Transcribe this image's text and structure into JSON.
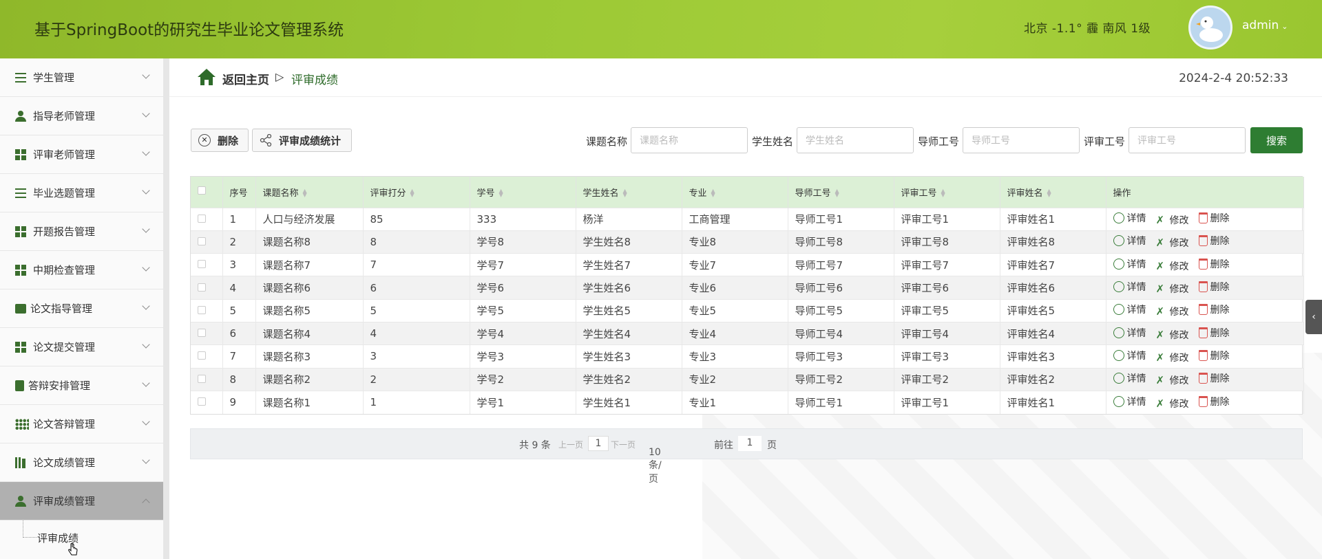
{
  "header": {
    "title": "基于SpringBoot的研究生毕业论文管理系统",
    "weather": "北京  -1.1°  霾  南风  1级",
    "username": "admin"
  },
  "sidebar": {
    "items": [
      {
        "label": "学生管理",
        "icon": "sliders-icon"
      },
      {
        "label": "指导老师管理",
        "icon": "user-icon"
      },
      {
        "label": "评审老师管理",
        "icon": "grid-icon"
      },
      {
        "label": "毕业选题管理",
        "icon": "list-icon"
      },
      {
        "label": "开题报告管理",
        "icon": "grid-icon"
      },
      {
        "label": "中期检查管理",
        "icon": "grid-icon"
      },
      {
        "label": "论文指导管理",
        "icon": "book-icon"
      },
      {
        "label": "论文提交管理",
        "icon": "grid-icon"
      },
      {
        "label": "答辩安排管理",
        "icon": "clipboard-icon"
      },
      {
        "label": "论文答辩管理",
        "icon": "dots-grid-icon"
      },
      {
        "label": "论文成绩管理",
        "icon": "books-icon"
      },
      {
        "label": "评审成绩管理",
        "icon": "user-icon"
      }
    ],
    "subitem": "评审成绩"
  },
  "breadcrumb": {
    "home": "返回主页",
    "separator": "▷",
    "current": "评审成绩"
  },
  "datetime": "2024-2-4 20:52:33",
  "toolbar": {
    "delete_label": "删除",
    "stats_label": "评审成绩统计",
    "search_label": "搜索",
    "fields": [
      {
        "label": "课题名称",
        "placeholder": "课题名称"
      },
      {
        "label": "学生姓名",
        "placeholder": "学生姓名"
      },
      {
        "label": "导师工号",
        "placeholder": "导师工号"
      },
      {
        "label": "评审工号",
        "placeholder": "评审工号"
      }
    ]
  },
  "table": {
    "headers": [
      "序号",
      "课题名称",
      "评审打分",
      "学号",
      "学生姓名",
      "专业",
      "导师工号",
      "评审工号",
      "评审姓名",
      "操作"
    ],
    "actions": {
      "detail": "详情",
      "edit": "修改",
      "delete": "删除"
    },
    "rows": [
      [
        "1",
        "人口与经济发展",
        "85",
        "333",
        "杨洋",
        "工商管理",
        "导师工号1",
        "评审工号1",
        "评审姓名1"
      ],
      [
        "2",
        "课题名称8",
        "8",
        "学号8",
        "学生姓名8",
        "专业8",
        "导师工号8",
        "评审工号8",
        "评审姓名8"
      ],
      [
        "3",
        "课题名称7",
        "7",
        "学号7",
        "学生姓名7",
        "专业7",
        "导师工号7",
        "评审工号7",
        "评审姓名7"
      ],
      [
        "4",
        "课题名称6",
        "6",
        "学号6",
        "学生姓名6",
        "专业6",
        "导师工号6",
        "评审工号6",
        "评审姓名6"
      ],
      [
        "5",
        "课题名称5",
        "5",
        "学号5",
        "学生姓名5",
        "专业5",
        "导师工号5",
        "评审工号5",
        "评审姓名5"
      ],
      [
        "6",
        "课题名称4",
        "4",
        "学号4",
        "学生姓名4",
        "专业4",
        "导师工号4",
        "评审工号4",
        "评审姓名4"
      ],
      [
        "7",
        "课题名称3",
        "3",
        "学号3",
        "学生姓名3",
        "专业3",
        "导师工号3",
        "评审工号3",
        "评审姓名3"
      ],
      [
        "8",
        "课题名称2",
        "2",
        "学号2",
        "学生姓名2",
        "专业2",
        "导师工号2",
        "评审工号2",
        "评审姓名2"
      ],
      [
        "9",
        "课题名称1",
        "1",
        "学号1",
        "学生姓名1",
        "专业1",
        "导师工号1",
        "评审工号1",
        "评审姓名1"
      ]
    ]
  },
  "pagination": {
    "total": "共 9 条",
    "prev": "上一页",
    "page": "1",
    "next": "下一页",
    "page_size": "10条/页",
    "goto_prefix": "前往",
    "goto_value": "1",
    "goto_suffix": "页"
  },
  "colors": {
    "header_green": "#9cc935",
    "accent_green": "#2e7d32",
    "table_header": "#dcf0d6"
  }
}
